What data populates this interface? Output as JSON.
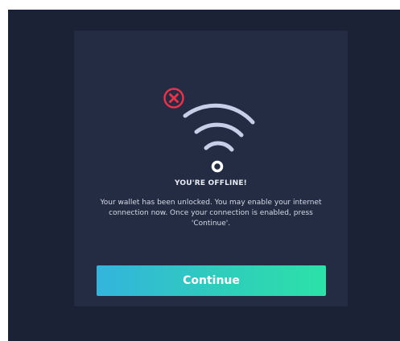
{
  "dialog": {
    "icons": {
      "error": "error-circle-x-icon",
      "wifi": "wifi-icon"
    },
    "heading": "YOU'RE OFFLINE!",
    "message": "Your wallet has been unlocked. You may enable your internet connection now. Once your connection is enabled, press 'Continue'.",
    "continue_label": "Continue"
  },
  "colors": {
    "window_background": "#1b2236",
    "dialog_background": "#232c43",
    "error_red": "#e8324a",
    "wifi_stroke": "#c7cee8",
    "button_gradient_start": "#33b4dd",
    "button_gradient_end": "#2ce2a8"
  }
}
